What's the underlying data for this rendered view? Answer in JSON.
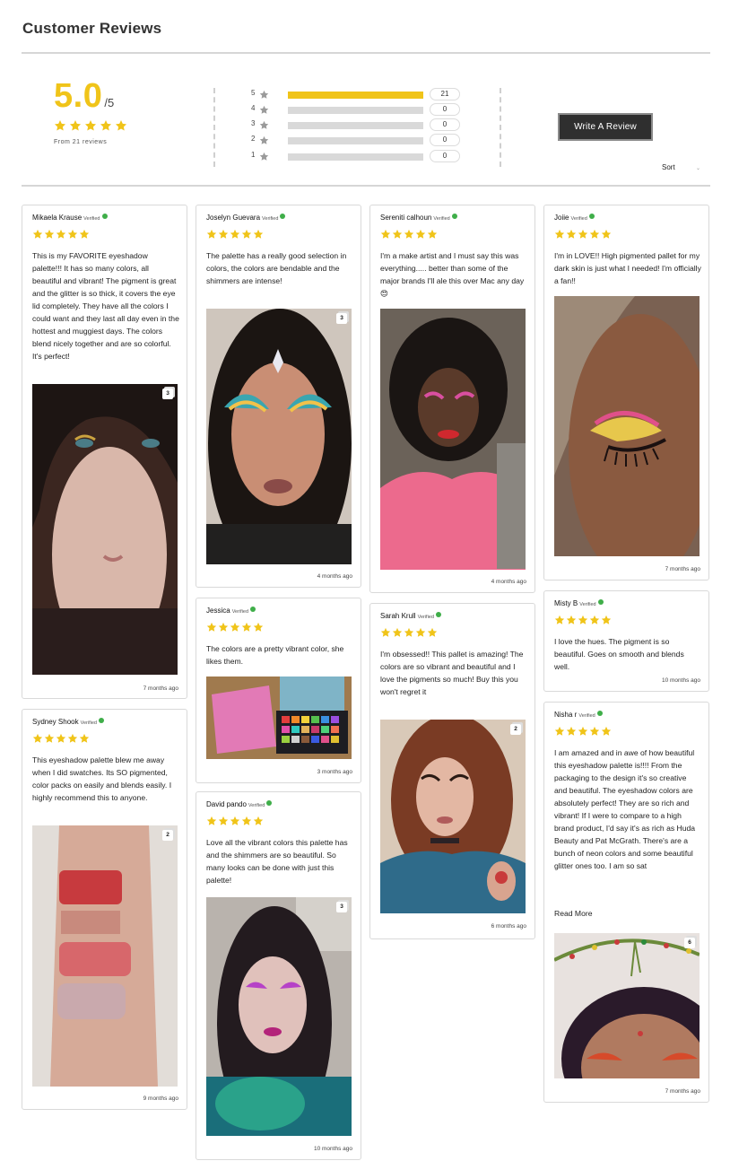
{
  "page_title": "Customer Reviews",
  "summary": {
    "average": "5.0",
    "out_of": "/5",
    "from_text": "From 21 reviews",
    "star_color": "#f0c419"
  },
  "rating_bars": [
    {
      "label": "5",
      "count": "21",
      "fraction": 1.0
    },
    {
      "label": "4",
      "count": "0",
      "fraction": 0.0
    },
    {
      "label": "3",
      "count": "0",
      "fraction": 0.0
    },
    {
      "label": "2",
      "count": "0",
      "fraction": 0.0
    },
    {
      "label": "1",
      "count": "0",
      "fraction": 0.0
    }
  ],
  "write_review_label": "Write A Review",
  "sort_label": "Sort",
  "verified_label": "Verified",
  "colors": {
    "star": "#f0c419",
    "verified_check": "#3fae49",
    "button_bg": "#2f2f2f"
  },
  "reviews": [
    {
      "name": "Mikaela Krause",
      "rating": 5,
      "text": "This is my FAVORITE eyeshadow palette!!! It has so many colors, all beautiful and vibrant! The pigment is great and the glitter is so thick, it covers the eye lid completely. They have all the colors I could want and they last all day even in the hottest and muggiest days. The colors blend nicely together and are so colorful. It's perfect!",
      "photo_count": "3",
      "date": "7 months ago"
    },
    {
      "name": "Sydney Shook",
      "rating": 5,
      "text": "This eyeshadow palette blew me away when I did swatches. Its SO pigmented, color packs on easily and blends easily. I highly recommend this to anyone.",
      "photo_count": "2",
      "date": "9 months ago"
    },
    {
      "name": "Joselyn Guevara",
      "rating": 5,
      "text": "The palette has a really good selection in colors, the colors are bendable and the shimmers are intense!",
      "photo_count": "3",
      "date": "4 months ago"
    },
    {
      "name": "Jessica",
      "rating": 5,
      "text": "The colors are a pretty vibrant color, she likes them.",
      "photo_count": "",
      "date": "3 months ago"
    },
    {
      "name": "David pando",
      "rating": 5,
      "text": "Love all the vibrant colors this palette has and the shimmers are so beautiful. So many looks can be done with just this palette!",
      "photo_count": "3",
      "date": "10 months ago"
    },
    {
      "name": "Sereniti calhoun",
      "rating": 5,
      "text": "I'm a make artist and I must say this was everything..... better than some of the major brands I'll ale this over Mac any day😍",
      "photo_count": "",
      "date": "4 months ago"
    },
    {
      "name": "Sarah Krull",
      "rating": 5,
      "text": "I'm obsessed!! This pallet is amazing! The colors are so vibrant and beautiful and I love the pigments so much! Buy this you won't regret it",
      "photo_count": "2",
      "date": "6 months ago"
    },
    {
      "name": "Joiie",
      "rating": 5,
      "text": "I'm in LOVE!! High pigmented pallet for my dark skin is just what I needed! I'm officially a fan!!",
      "photo_count": "",
      "date": "7 months ago"
    },
    {
      "name": "Misty B",
      "rating": 5,
      "text": "I love the hues. The pigment is so beautiful. Goes on smooth and blends well.",
      "photo_count": "",
      "date": "10 months ago"
    },
    {
      "name": "Nisha r",
      "rating": 5,
      "text": "I am amazed and in awe of how beautiful this eyeshadow palette is!!!! From the packaging to the design it's so creative and beautiful. The eyeshadow colors are absolutely perfect! They are so rich and vibrant! If I were to compare to a high brand product, I'd say it's as rich as Huda Beauty and Pat McGrath. There's are a bunch of neon colors and some beautiful glitter ones too. I am so sat",
      "read_more": "Read More",
      "photo_count": "6",
      "date": "7 months ago"
    }
  ]
}
